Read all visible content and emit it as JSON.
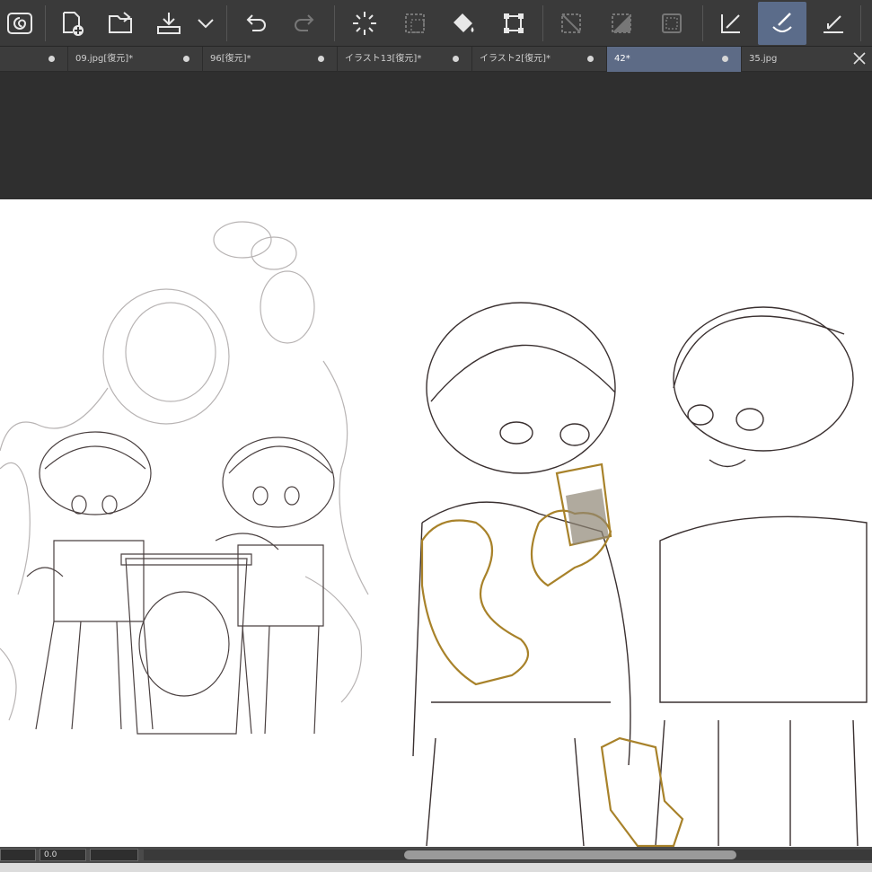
{
  "toolbar": {
    "buttons": [
      {
        "icon": "app-logo-icon",
        "title": "Clip Studio"
      },
      {
        "icon": "new-file-icon",
        "title": "New"
      },
      {
        "icon": "open-folder-icon",
        "title": "Open"
      },
      {
        "icon": "save-icon",
        "title": "Save"
      },
      {
        "icon": "chevron-down-icon",
        "title": "More"
      },
      {
        "icon": "undo-icon",
        "title": "Undo"
      },
      {
        "icon": "redo-icon",
        "title": "Redo"
      },
      {
        "icon": "loading-spinner-icon",
        "title": "Processing"
      },
      {
        "icon": "selection-icon",
        "title": "Selection"
      },
      {
        "icon": "fill-bucket-icon",
        "title": "Fill"
      },
      {
        "icon": "transform-icon",
        "title": "Transform"
      },
      {
        "icon": "clear-selection-icon",
        "title": "Clear"
      },
      {
        "icon": "invert-selection-icon",
        "title": "Invert"
      },
      {
        "icon": "selection-border-icon",
        "title": "Border"
      },
      {
        "icon": "pen-icon",
        "title": "Pen"
      },
      {
        "icon": "brush-icon",
        "title": "Brush"
      },
      {
        "icon": "pencil-ruler-icon",
        "title": "Pencil"
      }
    ],
    "active_tool": "brush-icon"
  },
  "tabs": [
    {
      "label": "",
      "modified": true
    },
    {
      "label": "09.jpg[復元]*",
      "modified": true
    },
    {
      "label": "96[復元]*",
      "modified": true
    },
    {
      "label": "イラスト13[復元]*",
      "modified": true
    },
    {
      "label": "イラスト2[復元]*",
      "modified": true
    },
    {
      "label": "42*",
      "modified": true,
      "active": true
    },
    {
      "label": "35.jpg",
      "modified": false
    }
  ],
  "status": {
    "zoom_value": "0.0"
  },
  "colors": {
    "toolbar_bg": "#3a3a3a",
    "active_accent": "#5b6c8a",
    "canvas_bg": "#2f2f2f",
    "sketch_ink": "#3a3030",
    "highlight_ink": "#a8822a"
  }
}
